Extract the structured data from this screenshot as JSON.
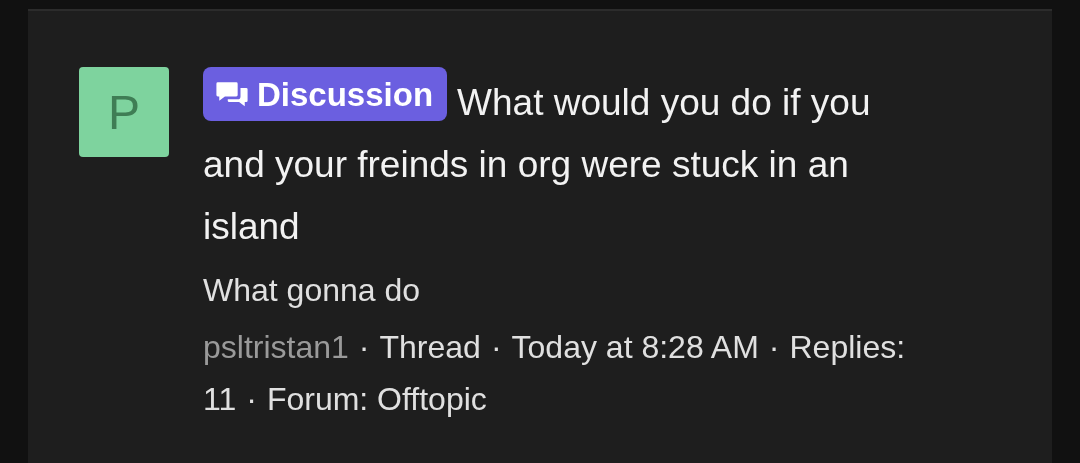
{
  "thread": {
    "avatar_letter": "P",
    "badge": {
      "label": "Discussion"
    },
    "title": "What would you do if you and your freinds in org were stuck in an island",
    "snippet": "What gonna do",
    "meta": {
      "author": "psltristan1",
      "separator": "·",
      "items": [
        "Thread",
        "Today at 8:28 AM",
        "Replies: 11",
        "Forum: Offtopic"
      ]
    }
  }
}
